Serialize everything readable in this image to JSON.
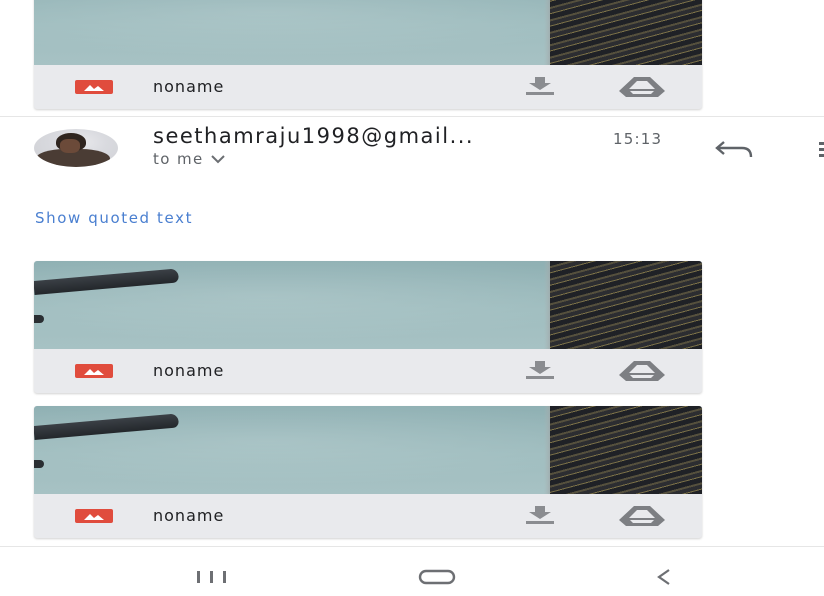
{
  "thread": {
    "top_attachment": {
      "name": "noname",
      "type_icon": "image-icon",
      "download_icon": "download-icon",
      "drive_icon": "save-to-drive-icon"
    },
    "message": {
      "avatar_icon": "avatar",
      "sender": "seethamraju1998@gmail...",
      "time": "15:13",
      "recipient": "to me",
      "recipient_toggle_icon": "chevron-down-icon",
      "reply_icon": "reply-icon",
      "more_icon": "more-icon",
      "quoted_text_link": "Show quoted text",
      "attachments": [
        {
          "name": "noname",
          "type_icon": "image-icon",
          "download_icon": "download-icon",
          "drive_icon": "save-to-drive-icon"
        },
        {
          "name": "noname",
          "type_icon": "image-icon",
          "download_icon": "download-icon",
          "drive_icon": "save-to-drive-icon"
        }
      ]
    }
  },
  "navbar": {
    "recents_icon": "recents-icon",
    "home_icon": "home-icon",
    "back_icon": "back-icon"
  },
  "colors": {
    "image_icon_red": "#e04c3d",
    "link_blue": "#4a7fd0",
    "icon_gray": "#7d7f83",
    "card_background": "#e9eaed"
  }
}
